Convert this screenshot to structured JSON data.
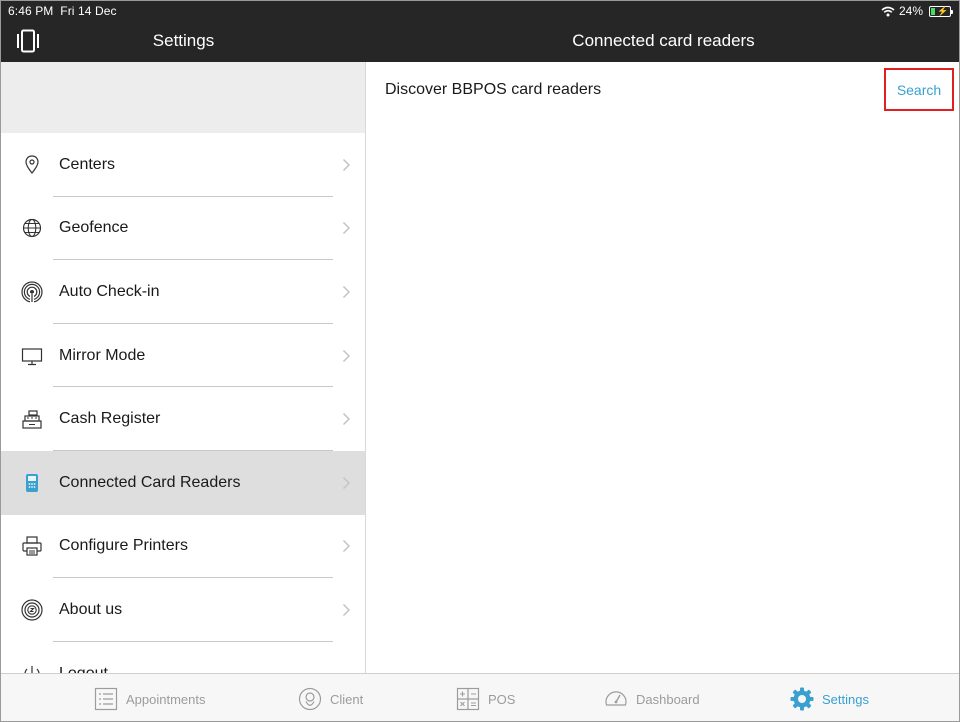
{
  "status_bar": {
    "time": "6:46 PM",
    "date": "Fri 14 Dec",
    "battery": "24%",
    "battery_level": 0.24
  },
  "nav": {
    "left_title": "Settings",
    "right_title": "Connected card readers"
  },
  "sidebar": {
    "items": [
      {
        "label": "Centers",
        "icon": "location-pin-icon",
        "selected": false
      },
      {
        "label": "Geofence",
        "icon": "globe-icon",
        "selected": false
      },
      {
        "label": "Auto Check-in",
        "icon": "broadcast-icon",
        "selected": false
      },
      {
        "label": "Mirror Mode",
        "icon": "monitor-icon",
        "selected": false
      },
      {
        "label": "Cash Register",
        "icon": "cash-register-icon",
        "selected": false
      },
      {
        "label": "Connected Card Readers",
        "icon": "card-reader-icon",
        "selected": true
      },
      {
        "label": "Configure Printers",
        "icon": "printer-icon",
        "selected": false
      },
      {
        "label": "About us",
        "icon": "info-badge-icon",
        "selected": false
      },
      {
        "label": "Logout",
        "icon": "power-icon",
        "selected": false
      }
    ]
  },
  "content": {
    "discover_label": "Discover BBPOS card readers",
    "search_label": "Search"
  },
  "tabbar": {
    "tabs": [
      {
        "label": "Appointments",
        "icon": "list-icon",
        "active": false
      },
      {
        "label": "Client",
        "icon": "person-icon",
        "active": false
      },
      {
        "label": "POS",
        "icon": "calculator-icon",
        "active": false
      },
      {
        "label": "Dashboard",
        "icon": "gauge-icon",
        "active": false
      },
      {
        "label": "Settings",
        "icon": "gear-icon",
        "active": true
      }
    ]
  },
  "colors": {
    "accent": "#3aa0d0",
    "nav_bg": "#262626",
    "highlight_border": "#e02020",
    "selected_row": "#dedede"
  }
}
